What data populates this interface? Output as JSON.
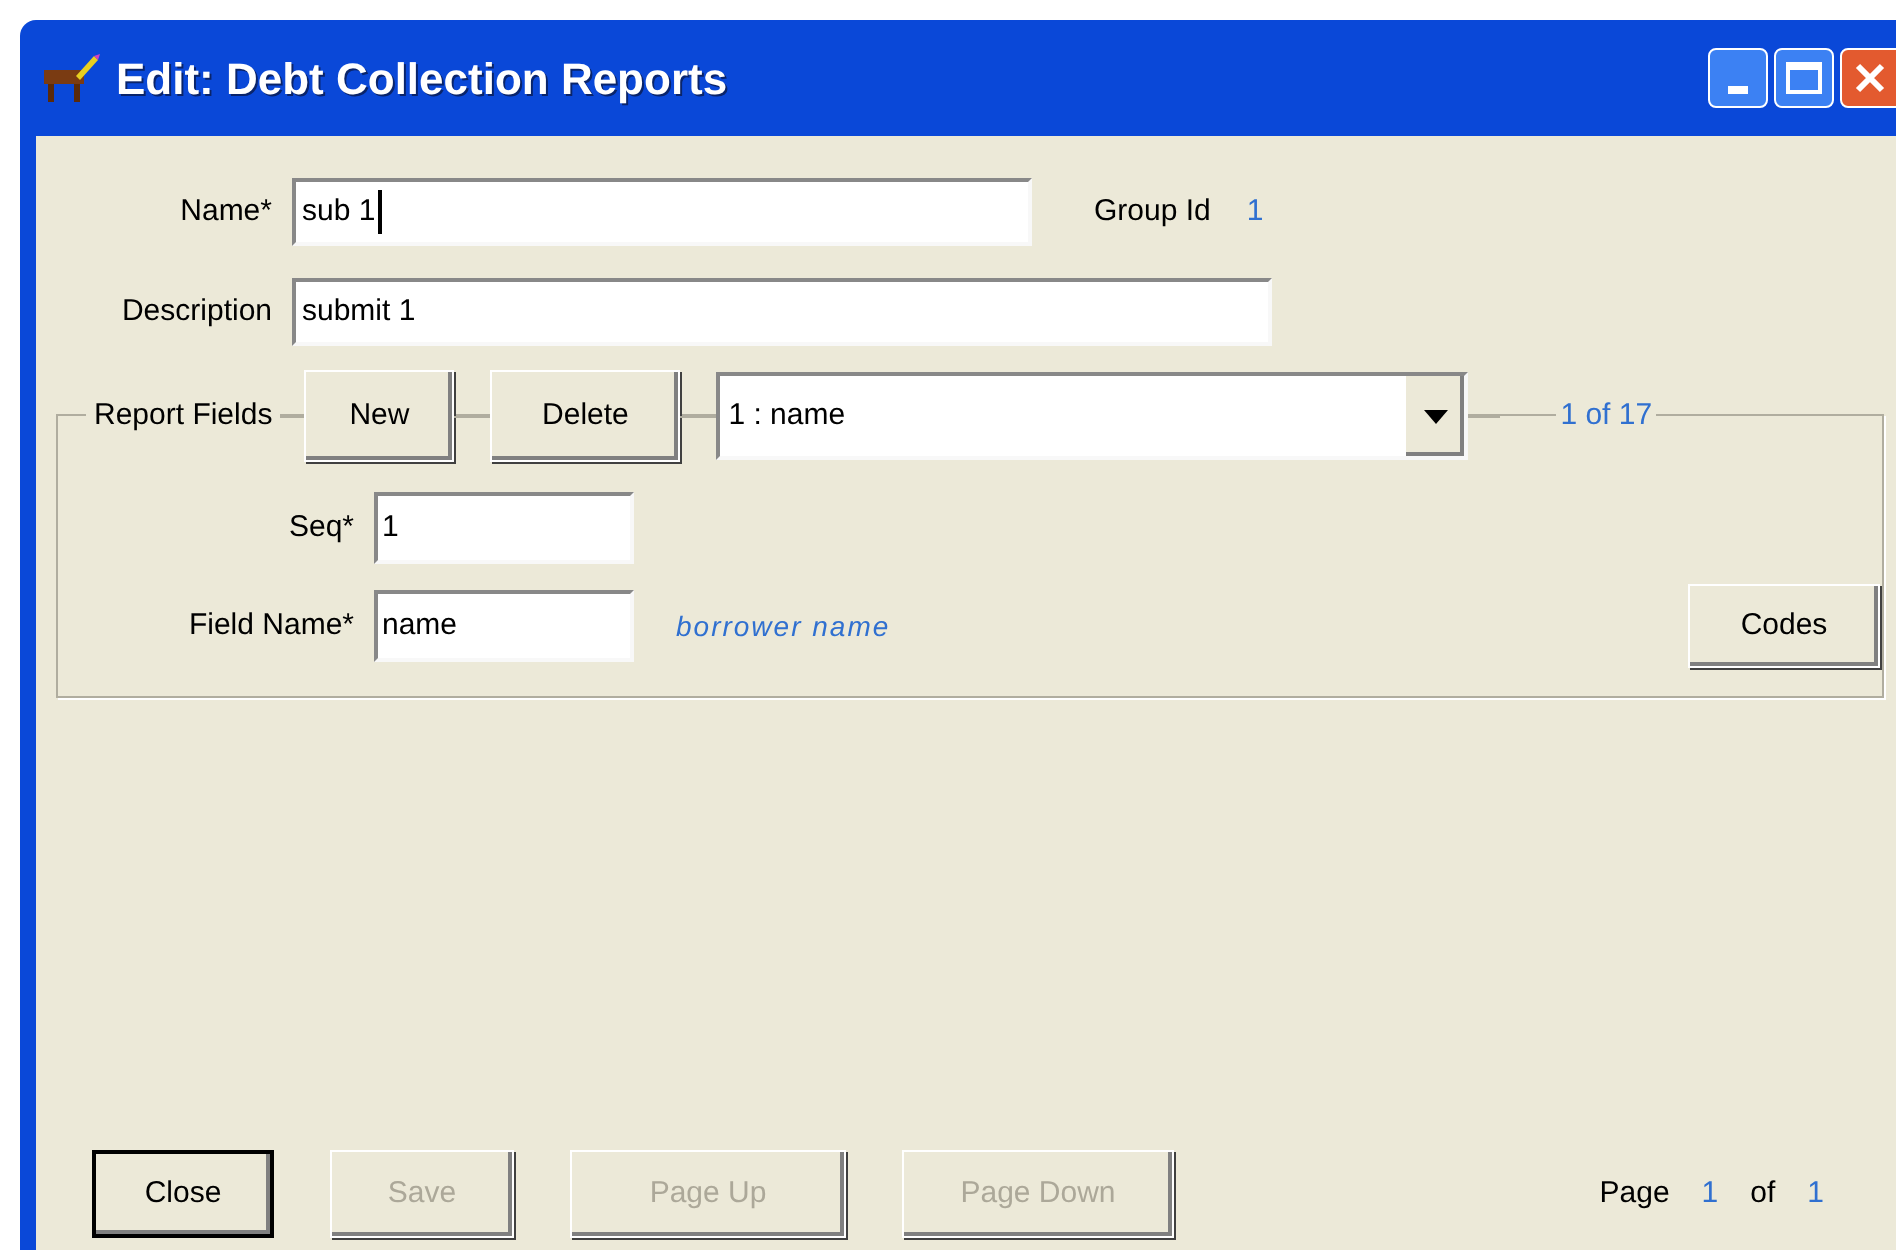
{
  "window": {
    "title": "Edit: Debt Collection Reports"
  },
  "fields": [
    {
      "label": "Name*",
      "value": "sub 1",
      "focused": true
    },
    {
      "label": "Description",
      "value": "submit 1"
    }
  ],
  "group_id": {
    "label": "Group Id",
    "value": "1"
  },
  "report_fields": {
    "title": "Report Fields",
    "buttons": [
      {
        "label": "New",
        "disabled": false
      },
      {
        "label": "Delete",
        "disabled": false
      }
    ],
    "selector": {
      "value": "1 : name"
    },
    "position": "1 of 17",
    "seq": {
      "label": "Seq*",
      "value": "1"
    },
    "field_name": {
      "label": "Field Name*",
      "value": "name",
      "hint": "borrower name"
    },
    "codes_button": {
      "label": "Codes"
    }
  },
  "footer_buttons": [
    {
      "label": "Close",
      "disabled": false,
      "default": true
    },
    {
      "label": "Save",
      "disabled": true,
      "default": false
    },
    {
      "label": "Page Up",
      "disabled": true,
      "default": false
    },
    {
      "label": "Page Down",
      "disabled": true,
      "default": false
    }
  ],
  "pager": {
    "label": "Page",
    "current": "1",
    "of": "of",
    "total": "1"
  }
}
